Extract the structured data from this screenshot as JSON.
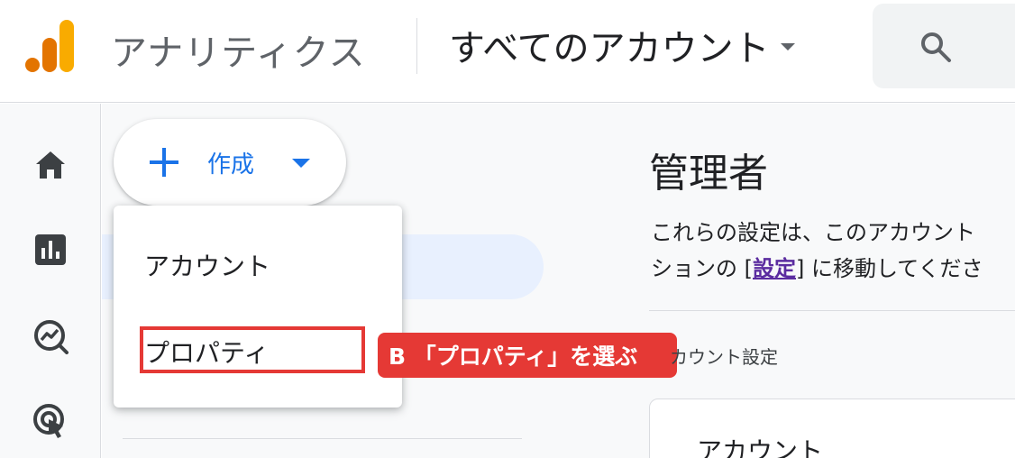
{
  "header": {
    "product_name": "アナリティクス",
    "account_picker_label": "すべてのアカウント",
    "search_hint": "「"
  },
  "nav": {
    "items": [
      {
        "icon": "home-icon"
      },
      {
        "icon": "reports-icon"
      },
      {
        "icon": "explore-icon"
      },
      {
        "icon": "advertising-icon"
      }
    ]
  },
  "create": {
    "label": "作成",
    "menu": [
      {
        "label": "アカウント"
      },
      {
        "label": "プロパティ"
      }
    ]
  },
  "annotation": {
    "callout": "B 「プロパティ」を選ぶ",
    "color": "#e53935"
  },
  "admin": {
    "title": "管理者",
    "desc_line1": "これらの設定は、このアカウント",
    "desc_line2_pre": "ションの [",
    "desc_link": "設定",
    "desc_line2_post": "] に移動してくださ",
    "account_settings_label": "カウント設定",
    "account_card_label": "アカウント"
  },
  "colors": {
    "accent": "#1a73e8",
    "logo_orange": "#f9ab00",
    "logo_dark_orange": "#e37400"
  }
}
